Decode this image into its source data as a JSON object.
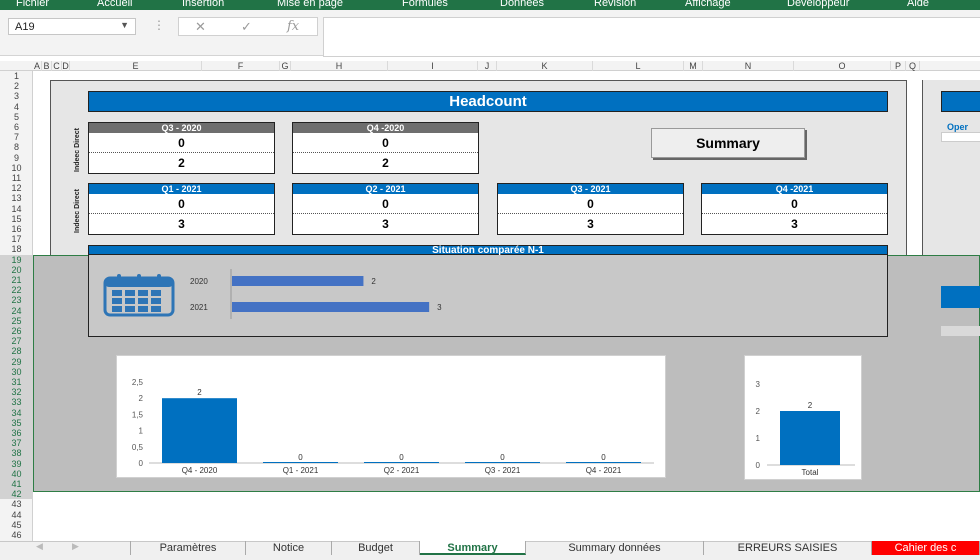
{
  "ribbon": {
    "tabs": [
      "Fichier",
      "Accueil",
      "Insertion",
      "Mise en page",
      "Formules",
      "Données",
      "Révision",
      "Affichage",
      "Développeur",
      "Aide"
    ]
  },
  "formula_bar": {
    "name_box": "A19",
    "cancel": "✕",
    "enter": "✓",
    "fx": "fx",
    "value": ""
  },
  "columns": [
    "A",
    "B",
    "C",
    "D",
    "E",
    "F",
    "G",
    "H",
    "I",
    "J",
    "K",
    "L",
    "M",
    "N",
    "O",
    "P",
    "Q"
  ],
  "rows": [
    "1",
    "2",
    "3",
    "4",
    "5",
    "6",
    "7",
    "8",
    "9",
    "10",
    "11",
    "12",
    "13",
    "14",
    "15",
    "16",
    "17",
    "18",
    "19",
    "20",
    "21",
    "22",
    "23",
    "24",
    "25",
    "26",
    "27",
    "28",
    "29",
    "30",
    "31",
    "32",
    "33",
    "34",
    "35",
    "36",
    "37",
    "38",
    "39",
    "40",
    "41",
    "42",
    "43",
    "44",
    "45",
    "46"
  ],
  "dashboard": {
    "title": "Headcount",
    "summary_button": "Summary",
    "side_label": "Indeec Direct",
    "q_2020": [
      {
        "label": "Q3 - 2020",
        "v1": "0",
        "v2": "2"
      },
      {
        "label": "Q4 -2020",
        "v1": "0",
        "v2": "2"
      }
    ],
    "q_2021": [
      {
        "label": "Q1 - 2021",
        "v1": "0",
        "v2": "3"
      },
      {
        "label": "Q2 - 2021",
        "v1": "0",
        "v2": "3"
      },
      {
        "label": "Q3 - 2021",
        "v1": "0",
        "v2": "3"
      },
      {
        "label": "Q4 -2021",
        "v1": "0",
        "v2": "3"
      }
    ],
    "situation_title": "Situation comparée N-1",
    "right_panel_label": "Oper"
  },
  "colors": {
    "accent": "#0070c0",
    "header_gray": "#6e6e6e",
    "excel_green": "#217346",
    "bar": "#4472c4"
  },
  "chart_data": [
    {
      "type": "bar",
      "orientation": "horizontal",
      "categories": [
        "2020",
        "2021"
      ],
      "values": [
        2,
        3
      ],
      "xlim": [
        0,
        3.5
      ]
    },
    {
      "type": "bar",
      "categories": [
        "Q4 - 2020",
        "Q1 - 2021",
        "Q2 - 2021",
        "Q3 - 2021",
        "Q4 - 2021"
      ],
      "values": [
        2,
        0,
        0,
        0,
        0
      ],
      "yticks": [
        "0",
        "0,5",
        "1",
        "1,5",
        "2",
        "2,5"
      ],
      "ylim": [
        0,
        2.5
      ]
    },
    {
      "type": "bar",
      "categories": [
        "Total"
      ],
      "values": [
        2
      ],
      "yticks": [
        "0",
        "1",
        "2",
        "3"
      ],
      "ylim": [
        0,
        3
      ]
    }
  ],
  "sheet_tabs": [
    "Paramètres",
    "Notice",
    "Budget",
    "Summary",
    "Summary données",
    "ERREURS SAISIES",
    "Cahier des c"
  ],
  "active_tab": "Summary"
}
